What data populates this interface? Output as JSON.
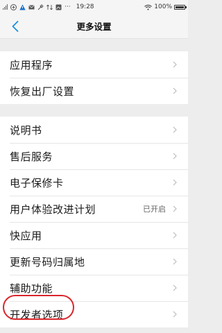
{
  "status_bar": {
    "left_icons": [
      "signal-icon",
      "alert-icon",
      "warning-icon",
      "mail-icon",
      "tools-icon",
      "data-icon",
      "image-icon",
      "more-icon"
    ],
    "more": "···",
    "time": "19:28",
    "battery": "100%"
  },
  "header": {
    "title": "更多设置"
  },
  "groups": [
    {
      "items": [
        {
          "label": "应用程序"
        },
        {
          "label": "恢复出厂设置"
        }
      ]
    },
    {
      "items": [
        {
          "label": "说明书"
        },
        {
          "label": "售后服务"
        },
        {
          "label": "电子保修卡"
        },
        {
          "label": "用户体验改进计划",
          "value": "已开启"
        },
        {
          "label": "快应用"
        },
        {
          "label": "更新号码归属地"
        },
        {
          "label": "辅助功能"
        },
        {
          "label": "开发者选项"
        }
      ]
    }
  ],
  "colors": {
    "accent": "#1a8fe0",
    "highlight": "#d9252b",
    "background": "#ededed"
  }
}
